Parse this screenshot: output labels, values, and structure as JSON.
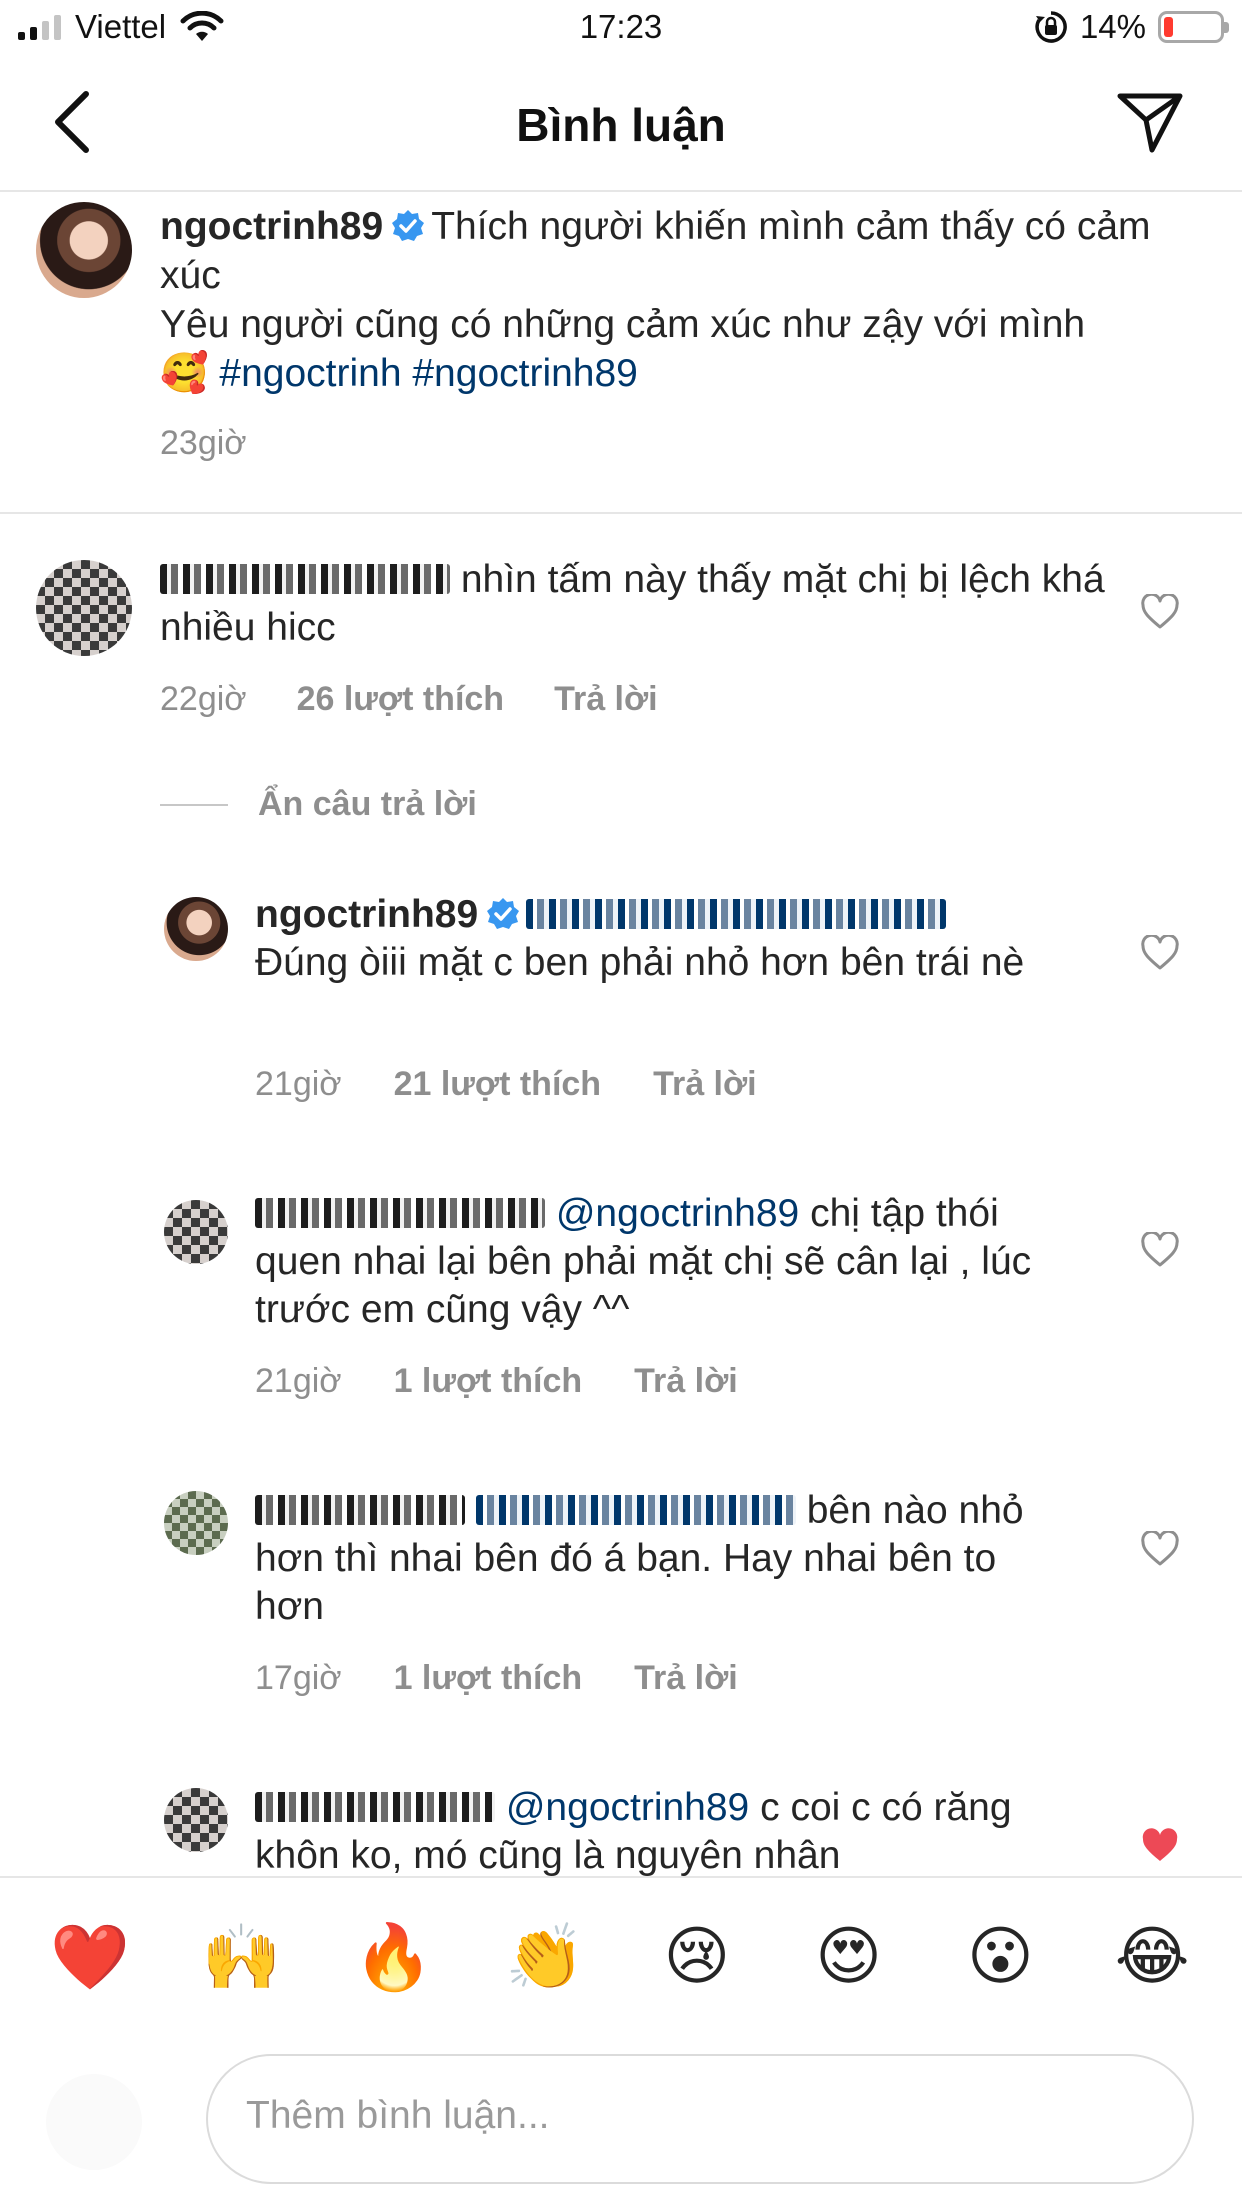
{
  "status_bar": {
    "carrier": "Viettel",
    "time": "17:23",
    "battery": "14%",
    "battery_level": 0.14
  },
  "header": {
    "title": "Bình luận"
  },
  "caption": {
    "username": "ngoctrinh89",
    "line1": "Thích người khiến mình cảm thấy có cảm xúc",
    "line2": "Yêu người cũng có những cảm xúc như zậy với mình",
    "emoji": "🥰",
    "hashtags": "#ngoctrinh #ngoctrinh89",
    "time": "23giờ"
  },
  "comments": [
    {
      "username_hidden": true,
      "text": "nhìn tấm này thấy mặt chị bị lệch khá nhiều hicc",
      "time": "22giờ",
      "likes": "26 lượt thích",
      "reply": "Trả lời",
      "liked": false
    }
  ],
  "hide_replies": "Ẩn câu trả lời",
  "replies": [
    {
      "username": "ngoctrinh89",
      "text": "Đúng òiii mặt c ben phải nhỏ hơn bên trái nè",
      "time": "21giờ",
      "likes": "21 lượt thích",
      "reply": "Trả lời",
      "liked": false
    },
    {
      "mention": "@ngoctrinh89",
      "text": "chị tập thói quen nhai lại bên phải mặt chị sẽ cân lại , lúc trước em cũng vậy ^^",
      "time": "21giờ",
      "likes": "1 lượt thích",
      "reply": "Trả lời",
      "liked": false
    },
    {
      "text": "bên nào nhỏ hơn thì nhai bên đó á bạn. Hay nhai bên to hơn",
      "time": "17giờ",
      "likes": "1 lượt thích",
      "reply": "Trả lời",
      "liked": false
    },
    {
      "mention": "@ngoctrinh89",
      "text": "c coi c có răng khôn ko, mó cũng là nguyên nhân",
      "liked": true
    }
  ],
  "emoji_bar": [
    "❤️",
    "🙌",
    "🔥",
    "👏",
    "😢",
    "😍",
    "😮",
    "😂"
  ],
  "input": {
    "placeholder": "Thêm bình luận..."
  },
  "colors": {
    "link": "#00376b",
    "verified": "#3897f0",
    "muted": "#8e8e8e",
    "like_red": "#ed4956"
  }
}
